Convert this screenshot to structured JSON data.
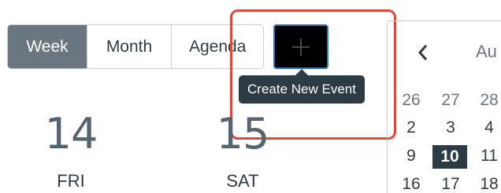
{
  "view_toggle": {
    "week": "Week",
    "month": "Month",
    "agenda": "Agenda"
  },
  "add_event": {
    "icon": "plus-icon",
    "tooltip": "Create New Event"
  },
  "days": [
    {
      "number": "14",
      "name": "FRI"
    },
    {
      "number": "15",
      "name": "SAT"
    }
  ],
  "mini_calendar": {
    "month_label": "Au",
    "rows": [
      [
        "26",
        "27",
        "28"
      ],
      [
        "2",
        "3",
        "4"
      ],
      [
        "9",
        "10",
        "11"
      ],
      [
        "16",
        "17",
        "18"
      ]
    ],
    "selected_day": "10"
  },
  "colors": {
    "active_toggle": "#6b7780",
    "tooltip_bg": "#2d3b45",
    "highlight": "#e0493a",
    "focus_ring": "#2b7abc"
  }
}
